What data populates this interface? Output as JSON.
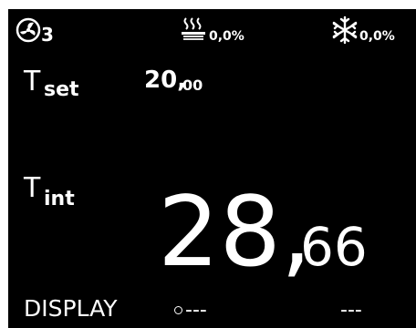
{
  "status_bar": {
    "pump_icon": "pump-fan-icon",
    "pump_stage": "3",
    "heater_icon": "heater-icon",
    "heater_output": "0,0%",
    "cooler_icon": "snowflake-icon",
    "cooler_output": "0,0%"
  },
  "setpoint": {
    "label_main": "T",
    "label_sub": "set",
    "value_int": "20,",
    "value_dec": "00"
  },
  "internal_temp": {
    "label_main": "T",
    "label_sub": "int",
    "value_int": "28,",
    "value_dec": "66"
  },
  "bottom_row": {
    "mode_label": "DISPLAY",
    "dot_icon": "circle-indicator-icon",
    "aux1": "---",
    "aux2": "---"
  },
  "colors": {
    "background": "#000000",
    "foreground": "#ffffff",
    "frame": "#ffffff"
  }
}
